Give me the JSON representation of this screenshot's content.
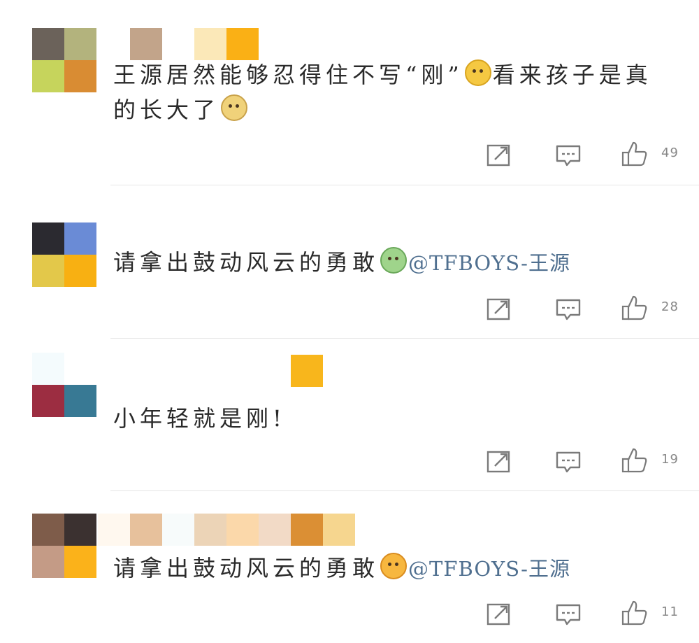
{
  "comments": [
    {
      "text_before": "王源居然能够忍得住不写“刚”",
      "text_middle": "看来孩子是真的长大了",
      "mention": "",
      "like_count": "49"
    },
    {
      "text_before": "请拿出鼓动风云的勇敢",
      "text_middle": "",
      "mention": "@TFBOYS-王源",
      "like_count": "28"
    },
    {
      "text_before": "小年轻就是刚!",
      "text_middle": "",
      "mention": "",
      "like_count": "19"
    },
    {
      "text_before": "请拿出鼓动风云的勇敢",
      "text_middle": "",
      "mention": "@TFBOYS-王源",
      "like_count": "11"
    }
  ],
  "icons": {
    "share": "share-icon",
    "reply": "comment-icon",
    "like": "thumbs-up-icon"
  },
  "colors": {
    "mention": "#4f6f8f",
    "icon": "#777777",
    "divider": "#e6e6e6"
  }
}
